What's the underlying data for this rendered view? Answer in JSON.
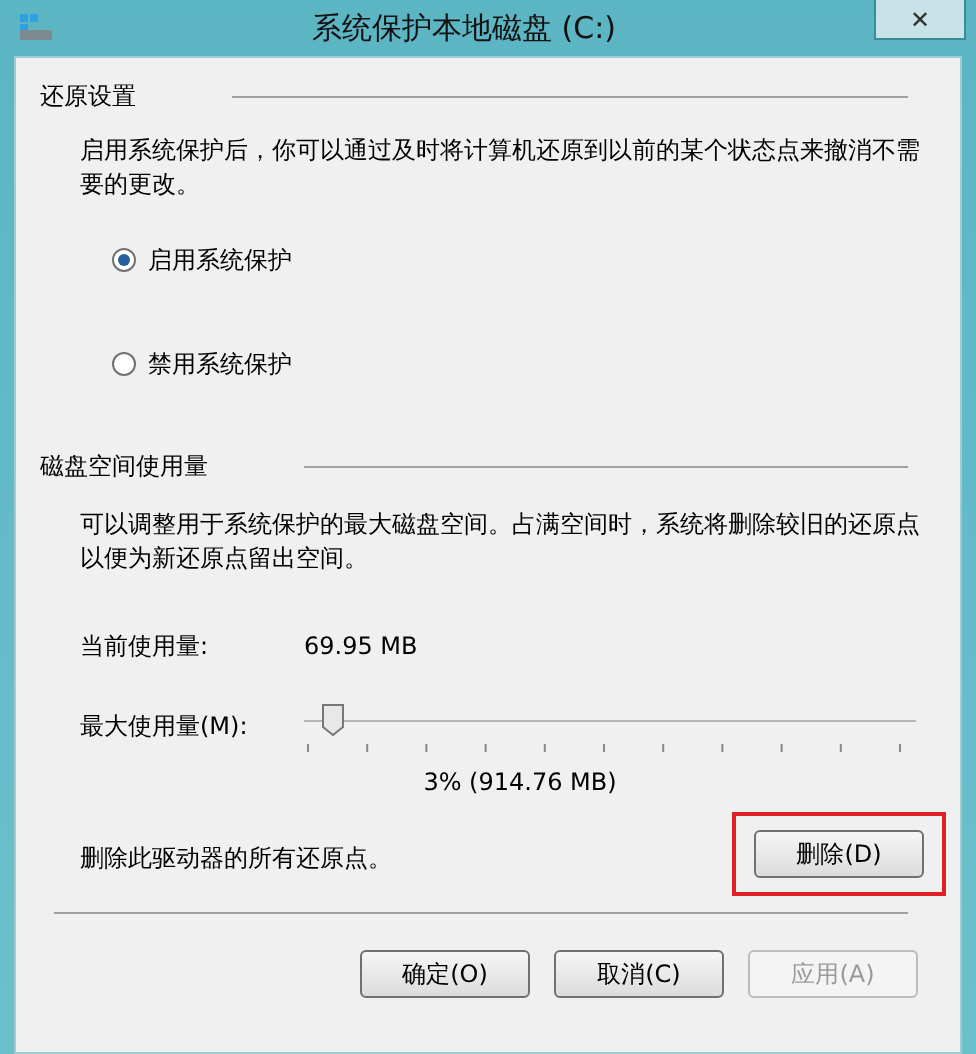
{
  "window": {
    "title": "系统保护本地磁盘 (C:)",
    "close": "✕"
  },
  "restore_settings": {
    "heading": "还原设置",
    "description": "启用系统保护后，你可以通过及时将计算机还原到以前的某个状态点来撤消不需要的更改。",
    "options": [
      {
        "label": "启用系统保护",
        "selected": true
      },
      {
        "label": "禁用系统保护",
        "selected": false
      }
    ]
  },
  "disk_usage": {
    "heading": "磁盘空间使用量",
    "description": "可以调整用于系统保护的最大磁盘空间。占满空间时，系统将删除较旧的还原点以便为新还原点留出空间。",
    "current_label": "当前使用量:",
    "current_value": "69.95 MB",
    "max_label": "最大使用量(M):",
    "max_slider": {
      "level": 0.03
    },
    "max_reading": "3% (914.76 MB)"
  },
  "delete": {
    "description": "删除此驱动器的所有还原点。",
    "button": "删除(D)",
    "highlighted": true
  },
  "buttons": [
    {
      "label": "确定(O)",
      "disabled": false
    },
    {
      "label": "取消(C)",
      "disabled": false
    },
    {
      "label": "应用(A)",
      "disabled": true
    }
  ]
}
